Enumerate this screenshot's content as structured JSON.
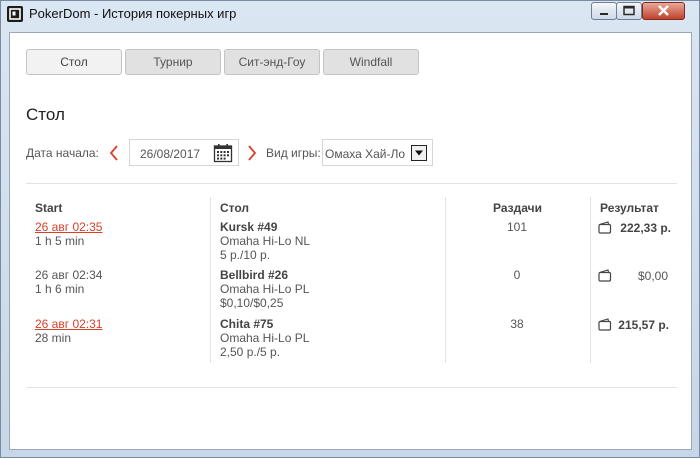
{
  "window": {
    "title": "PokerDom - История покерных игр"
  },
  "tabs": [
    {
      "label": "Стол",
      "active": true
    },
    {
      "label": "Турнир",
      "active": false
    },
    {
      "label": "Сит-энд-Гоу",
      "active": false
    },
    {
      "label": "Windfall",
      "active": false
    }
  ],
  "section_title": "Стол",
  "filters": {
    "date_label": "Дата начала:",
    "date_value": "26/08/2017",
    "game_type_label": "Вид игры:",
    "game_type_value": "Омаха Хай-Ло"
  },
  "table": {
    "headers": {
      "start": "Start",
      "table": "Стол",
      "hands": "Раздачи",
      "result": "Результат"
    },
    "rows": [
      {
        "start": "26 авг 02:35",
        "duration": "1 h 5 min",
        "linked": true,
        "table_name": "Kursk #49",
        "game": "Omaha Hi-Lo NL",
        "stakes": "5 р./10 р.",
        "hands": "101",
        "result": "222,33 р."
      },
      {
        "start": "26 авг 02:34",
        "duration": "1 h 6 min",
        "linked": false,
        "table_name": "Bellbird #26",
        "game": "Omaha Hi-Lo PL",
        "stakes": "$0,10/$0,25",
        "hands": "0",
        "result": "$0,00"
      },
      {
        "start": "26 авг 02:31",
        "duration": "28 min",
        "linked": true,
        "table_name": "Chita #75",
        "game": "Omaha Hi-Lo PL",
        "stakes": "2,50 р./5 р.",
        "hands": "38",
        "result": "215,57 р."
      }
    ]
  },
  "colors": {
    "link": "#d8402b",
    "close_button": "#c0412b",
    "arrow": "#d8402b"
  }
}
